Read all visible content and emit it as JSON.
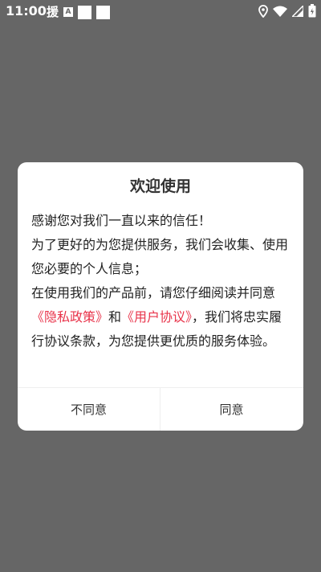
{
  "status_bar": {
    "time": "11:00",
    "notification_app_text": "援",
    "notification_a_text": "A"
  },
  "dialog": {
    "title": "欢迎使用",
    "line1": "感谢您对我们一直以来的信任！",
    "line2": "为了更好的为您提供服务，我们会收集、使用您必要的个人信息；",
    "line3_prefix": "在使用我们的产品前，请您仔细阅读并同意",
    "privacy_link": "《隐私政策》",
    "and_text": "和",
    "agreement_link": "《用户协议》",
    "line3_suffix": "，我们将忠实履行协议条款，为您提供更优质的服务体验。",
    "disagree_label": "不同意",
    "agree_label": "同意"
  },
  "colors": {
    "overlay": "#666666",
    "link": "#e8334a",
    "dialog_bg": "#ffffff"
  },
  "icons": [
    "location-icon",
    "wifi-icon",
    "cellular-icon",
    "battery-icon"
  ]
}
